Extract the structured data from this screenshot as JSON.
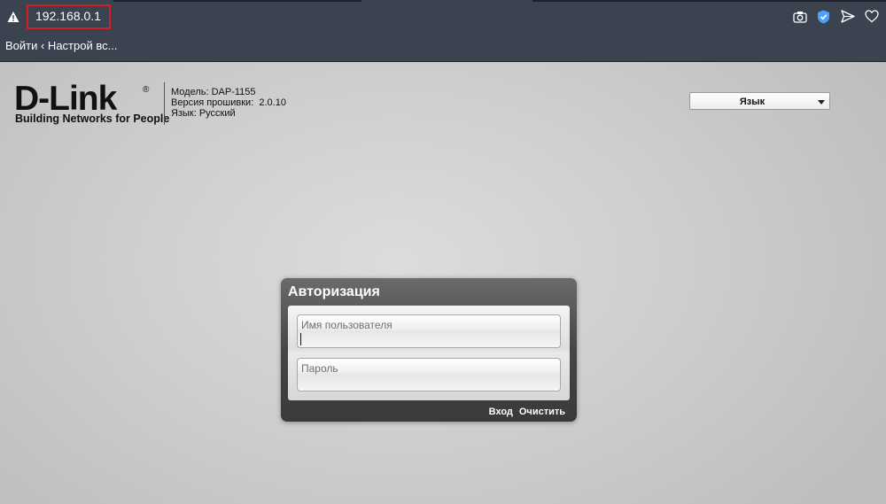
{
  "browser": {
    "url": "192.168.0.1",
    "tab_title": "Войти ‹ Настрой вс...",
    "icons": [
      "warning-icon",
      "camera-icon",
      "shield-icon",
      "send-icon",
      "heart-icon"
    ],
    "highlight_color": "#d41f26"
  },
  "header": {
    "logo": {
      "brand": "D-Link",
      "tagline": "Building Networks for People",
      "registered_mark": "®"
    },
    "model_label": "Модель: DAP-1155",
    "firmware_label": "Версия прошивки:  2.0.10",
    "language_label": "Язык: Русский",
    "language_select": {
      "value": "Язык"
    }
  },
  "auth": {
    "title": "Авторизация",
    "username_placeholder": "Имя пользователя",
    "password_placeholder": "Пароль",
    "login_label": "Вход",
    "clear_label": "Очистить"
  }
}
